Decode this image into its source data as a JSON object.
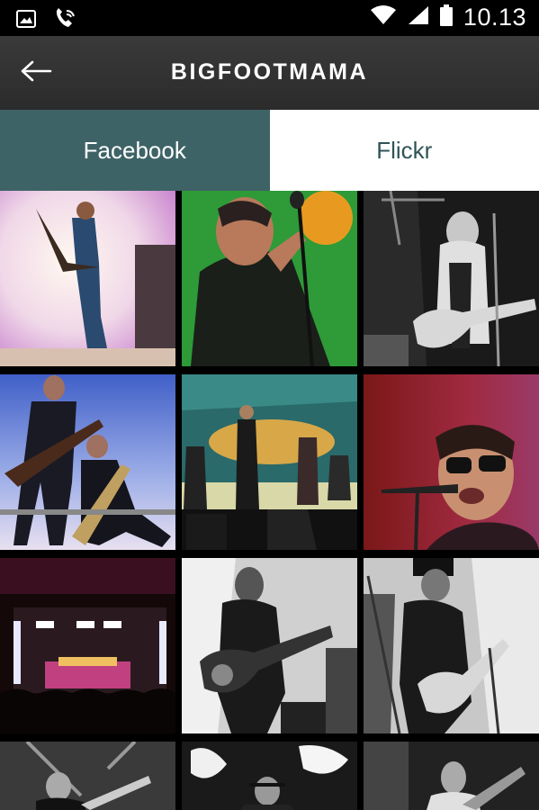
{
  "status_bar": {
    "time": "10.13",
    "icons": [
      "image-icon",
      "phone-wifi-icon",
      "wifi-icon",
      "signal-icon",
      "battery-icon"
    ]
  },
  "app_bar": {
    "title": "BIGFOOTMAMA",
    "back_icon": "back-arrow-icon"
  },
  "tabs": [
    {
      "label": "Facebook",
      "active": true
    },
    {
      "label": "Flickr",
      "active": false
    }
  ],
  "colors": {
    "tab_active_bg": "#3e6366",
    "tab_inactive_text": "#2f5457",
    "app_bar_bg": "#333333"
  },
  "gallery": {
    "photos": [
      "guitarist-bright-stage",
      "singer-green-light",
      "guitarist-black-white",
      "two-guitarists-stage",
      "band-teal-stage",
      "singer-sunglasses-red",
      "festival-stage-crowd",
      "guitarist-bw-smoke",
      "guitarist-bw-hat",
      "guitarist-bw-rig",
      "singer-bw-spotlight",
      "guitarist-bw-partial"
    ]
  }
}
